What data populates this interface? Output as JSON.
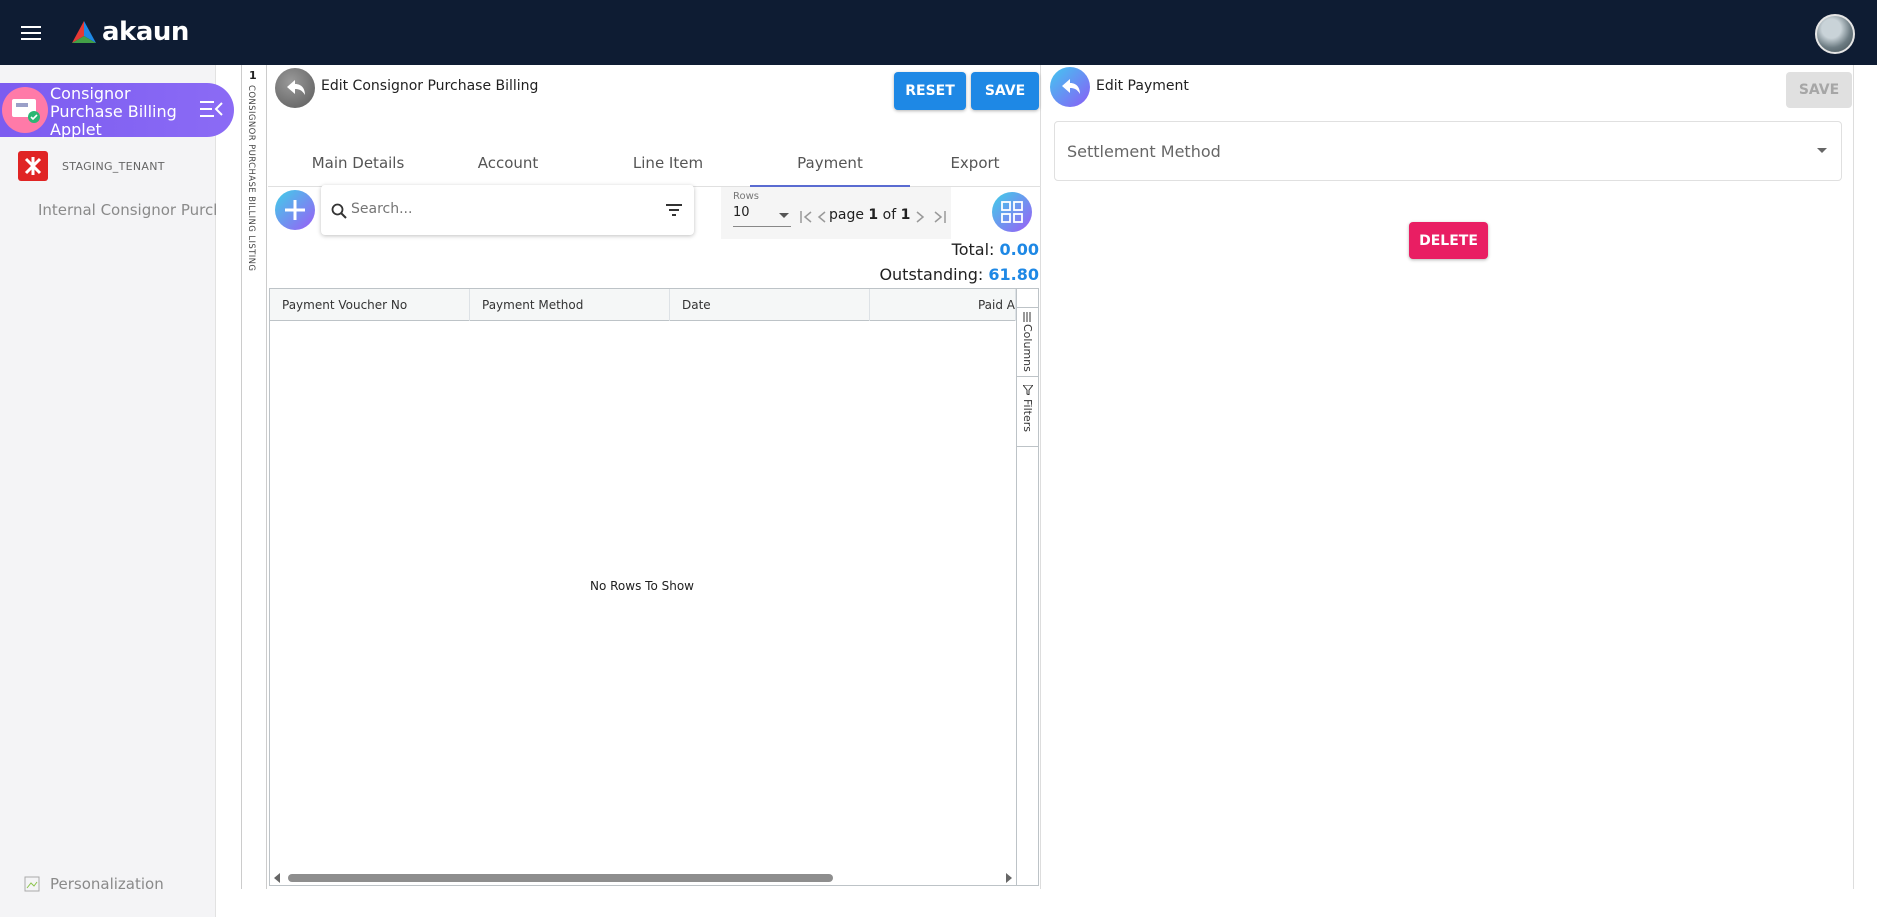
{
  "app": {
    "logo_text": "akaun"
  },
  "sidebar": {
    "applet_title": "Consignor Purchase Billing Applet",
    "tenant": "STAGING_TENANT",
    "link": "Internal Consignor Purchase Billing",
    "personalization": "Personalization"
  },
  "listing_strip": {
    "number": "1",
    "label": "CONSIGNOR PURCHASE BILLING LISTING"
  },
  "edit_panel": {
    "title": "Edit Consignor Purchase Billing",
    "reset_label": "RESET",
    "save_label": "SAVE",
    "tabs": [
      "Main Details",
      "Account",
      "Line Item",
      "Payment",
      "Export"
    ],
    "active_tab": "Payment",
    "search_placeholder": "Search...",
    "rows_label": "Rows",
    "rows_value": "10",
    "page_word": "page",
    "page_current": "1",
    "of_word": "of",
    "page_total": "1",
    "total_label": "Total:",
    "total_value": "0.00",
    "outstanding_label": "Outstanding:",
    "outstanding_value": "61.80",
    "columns": [
      "Payment Voucher No",
      "Payment Method",
      "Date",
      "Paid A"
    ],
    "no_rows": "No Rows To Show",
    "tool_columns": "Columns",
    "tool_filters": "Filters"
  },
  "payment_panel": {
    "title": "Edit Payment",
    "save_label": "SAVE",
    "settlement_label": "Settlement Method",
    "delete_label": "DELETE"
  },
  "colors": {
    "topbar": "#0e1c33",
    "primary": "#1e88e5",
    "danger": "#e91e63",
    "applet": "#8b5cf6"
  }
}
